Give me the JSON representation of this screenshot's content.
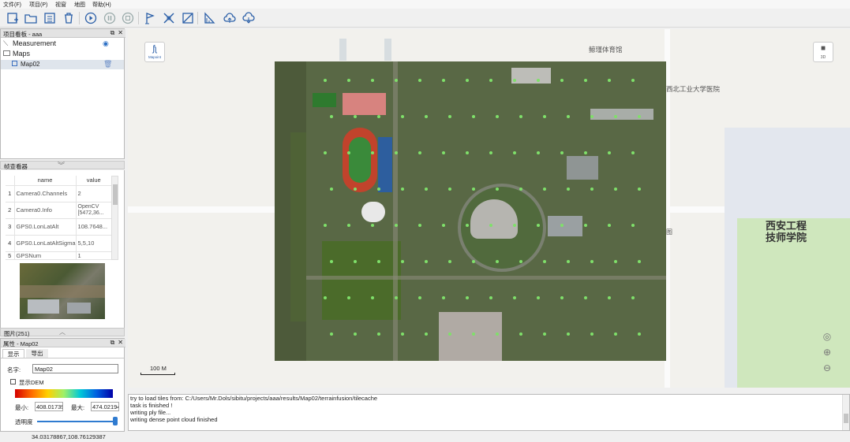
{
  "menu": [
    "文件(F)",
    "项目(P)",
    "视窗",
    "地图",
    "帮助(H)"
  ],
  "toolbar_icons": [
    "new-project-icon",
    "open-folder-icon",
    "list-icon",
    "trash-icon",
    "play-icon",
    "pause-icon",
    "stop-icon",
    "flag-icon",
    "crosshair-icon",
    "measure-box-icon",
    "ruler-icon",
    "cloud-upload-icon",
    "cloud-download-icon"
  ],
  "project_panel": {
    "title": "项目看板 - aaa",
    "items": [
      {
        "label": "Measurement",
        "icon": "measurement-icon",
        "action": "eye-icon"
      },
      {
        "label": "Maps",
        "icon": "folder-icon"
      },
      {
        "label": "Map02",
        "icon": "map-item-icon",
        "action": "trash-icon"
      }
    ]
  },
  "frame_viewer": {
    "title": "帧查看器",
    "columns": [
      "name",
      "value"
    ],
    "rows": [
      {
        "idx": "1",
        "name": "Camera0.Channels",
        "value": "2"
      },
      {
        "idx": "2",
        "name": "Camera0.Info",
        "value": "OpenCV [5472,36..."
      },
      {
        "idx": "3",
        "name": "GPS0.LonLatAlt",
        "value": "108.7648..."
      },
      {
        "idx": "4",
        "name": "GPS0.LonLatAltSigma",
        "value": "5,5,10"
      },
      {
        "idx": "5",
        "name": "GPSNum",
        "value": "1"
      }
    ]
  },
  "images_bar": {
    "label": "图片(251)"
  },
  "properties_panel": {
    "title": "属性 - Map02",
    "tabs": [
      "显示",
      "导出"
    ],
    "name_label": "名字:",
    "name_value": "Map02",
    "dem_label": "显示DEM",
    "min_label": "最小:",
    "min_value": "408.01739",
    "max_label": "最大:",
    "max_value": "474.02194",
    "opacity_label": "透明度"
  },
  "map": {
    "labels": [
      "鲸瑾体育馆",
      "西北工业大学医院",
      "西安工程技师学院",
      "图"
    ],
    "scale": "100 M",
    "btn_left": "Mapoint",
    "btn_right": "3D"
  },
  "log": [
    "try to load tiles from: C:/Users/Mr.Dols/sibitu/projects/aaa/results/Map02/terrainfusion/tilecache",
    "task is finished !",
    "writing ply file...",
    "writing dense point cloud finished"
  ],
  "status": {
    "coords": "34.03178867,108.76129387"
  }
}
